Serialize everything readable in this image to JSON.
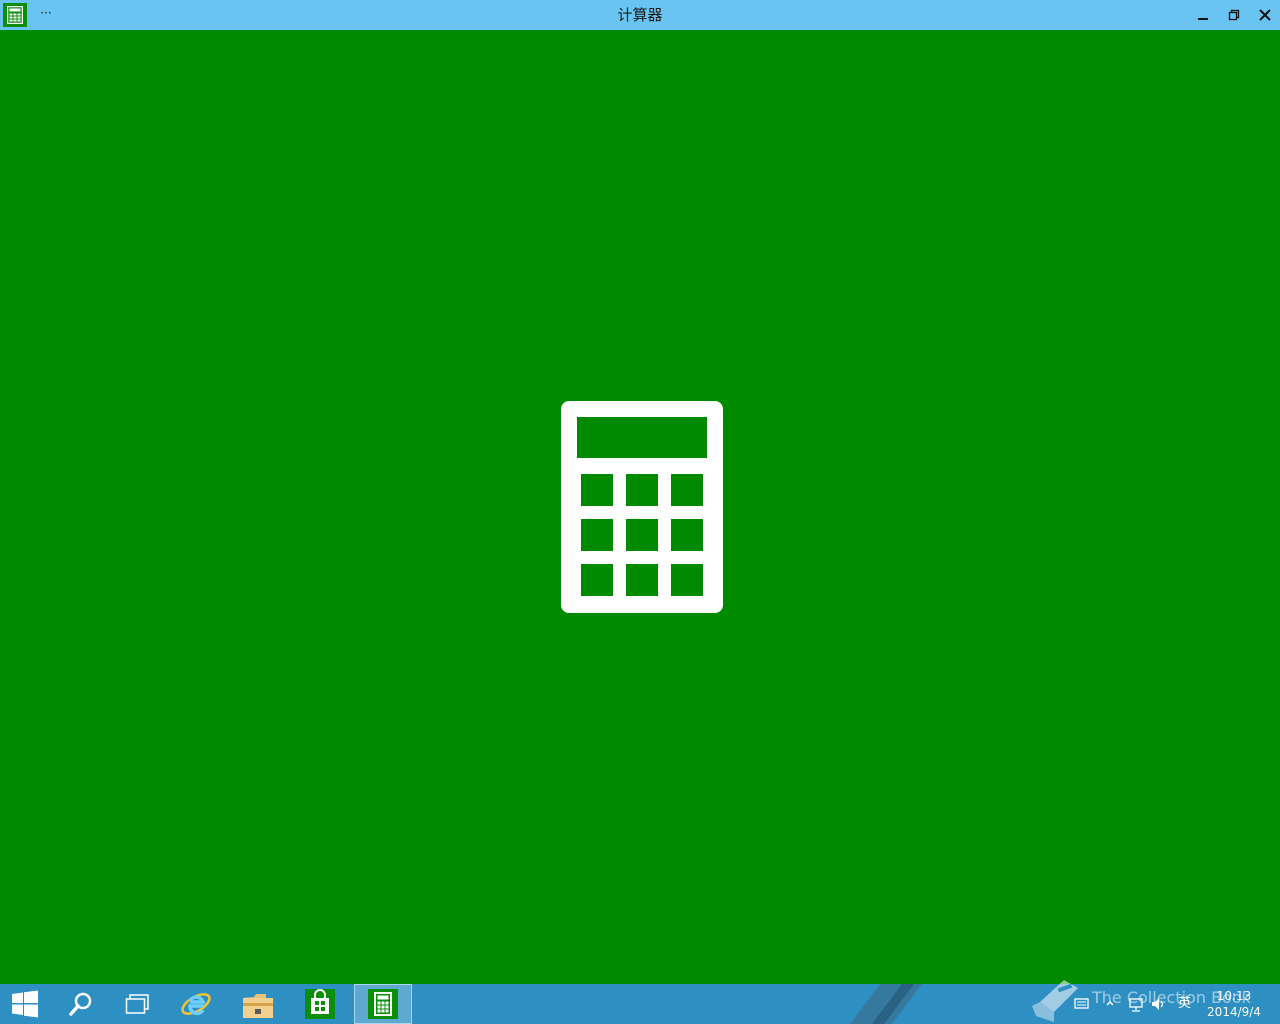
{
  "window": {
    "title": "计算器",
    "menu_label": "···"
  },
  "tray": {
    "watermark": "The Collection Book",
    "ime_label": "英",
    "time": "10:13",
    "date": "2014/9/4"
  },
  "colors": {
    "titlebar": "#6ac4f2",
    "splash_background": "#008a00",
    "taskbar": "#2e8fc2",
    "calc_tile": "#0b8f0b"
  },
  "icons": {
    "app": "calculator-icon",
    "minimize": "minimize-icon",
    "restore": "restore-icon",
    "close": "close-icon",
    "start": "windows-start-icon",
    "search": "search-icon",
    "task_view": "task-view-icon",
    "ie": "internet-explorer-icon",
    "explorer": "file-explorer-icon",
    "store": "store-icon",
    "calc_taskbar": "calculator-icon"
  }
}
